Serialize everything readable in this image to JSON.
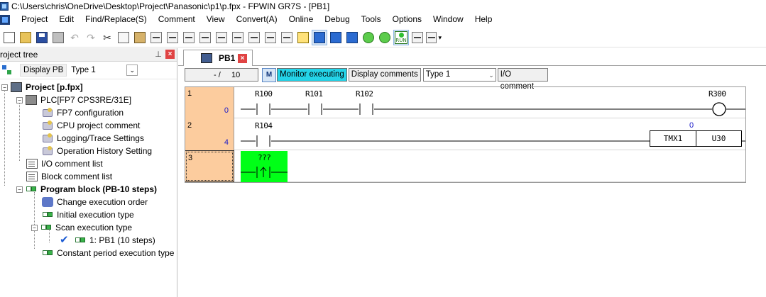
{
  "window": {
    "title": "C:\\Users\\chris\\OneDrive\\Desktop\\Project\\Panasonic\\p1\\p.fpx - FPWIN GR7S - [PB1]"
  },
  "menu": [
    "Project",
    "Edit",
    "Find/Replace(S)",
    "Comment",
    "View",
    "Convert(A)",
    "Online",
    "Debug",
    "Tools",
    "Options",
    "Window",
    "Help"
  ],
  "toolbar": {
    "run_label": "RUN"
  },
  "project_tree": {
    "title": "roject tree",
    "display_pb": "Display PB",
    "type_value": "Type 1",
    "items": [
      {
        "label": "Project [p.fpx]",
        "bold": true
      },
      {
        "label": "PLC[FP7 CPS3RE/31E]"
      },
      {
        "label": "FP7 configuration"
      },
      {
        "label": "CPU project comment"
      },
      {
        "label": "Logging/Trace Settings"
      },
      {
        "label": "Operation History Setting"
      },
      {
        "label": "I/O comment list"
      },
      {
        "label": "Block comment list"
      },
      {
        "label": "Program block (PB-10 steps)",
        "bold": true
      },
      {
        "label": "Change execution order"
      },
      {
        "label": "Initial execution type"
      },
      {
        "label": "Scan execution type"
      },
      {
        "label": "1: PB1 (10 steps)"
      },
      {
        "label": "Constant period execution type"
      }
    ]
  },
  "editor": {
    "tab_label": "PB1",
    "step_current": "- /",
    "step_total": "10",
    "monitor_status": "Monitor executing",
    "display_comments": "Display comments",
    "comment_type": "Type 1",
    "io_comment": "I/O comment",
    "rows": [
      {
        "line": "1",
        "step": "0",
        "contacts": [
          "R100",
          "R101",
          "R102"
        ],
        "coil": "R300"
      },
      {
        "line": "2",
        "step": "4",
        "contacts": [
          "R104"
        ],
        "instruction": "TMX1",
        "operand": "U30",
        "value": "0"
      },
      {
        "line": "3",
        "step": "",
        "pending": "???"
      }
    ]
  },
  "colors": {
    "row_number_bg": "#fccc9e",
    "monitor_bg": "#24d4e8",
    "green_cell": "#00ff17",
    "close_red": "#e04343"
  }
}
